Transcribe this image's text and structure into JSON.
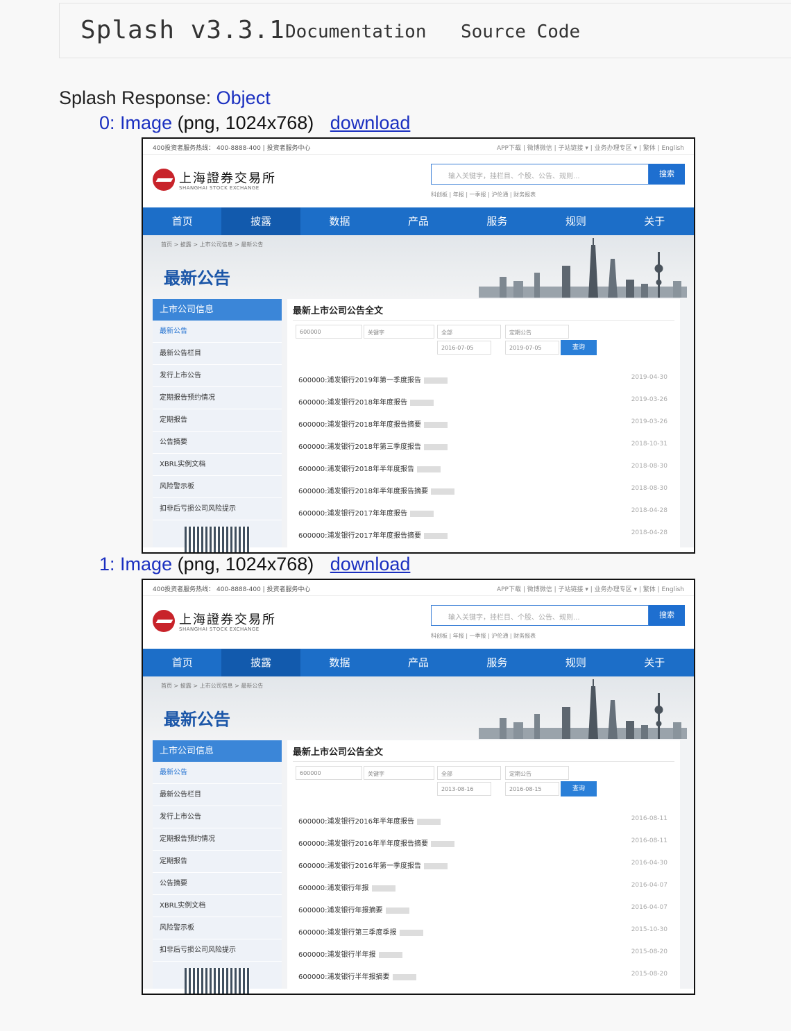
{
  "nav": {
    "brand": "Splash v3.3.1",
    "links": [
      "Documentation",
      "Source Code"
    ]
  },
  "response": {
    "label": "Splash Response:",
    "type": "Object"
  },
  "items": [
    {
      "index": "0:",
      "kind": "Image",
      "meta": "(png, 1024x768)",
      "link": "download",
      "shot": {
        "date_from": "2016-07-05",
        "date_to": "2019-07-05",
        "rows": [
          {
            "title": "600000:浦发银行2019年第一季度报告",
            "date": "2019-04-30"
          },
          {
            "title": "600000:浦发银行2018年年度报告",
            "date": "2019-03-26"
          },
          {
            "title": "600000:浦发银行2018年年度报告摘要",
            "date": "2019-03-26"
          },
          {
            "title": "600000:浦发银行2018年第三季度报告",
            "date": "2018-10-31"
          },
          {
            "title": "600000:浦发银行2018年半年度报告",
            "date": "2018-08-30"
          },
          {
            "title": "600000:浦发银行2018年半年度报告摘要",
            "date": "2018-08-30"
          },
          {
            "title": "600000:浦发银行2017年年度报告",
            "date": "2018-04-28"
          },
          {
            "title": "600000:浦发银行2017年年度报告摘要",
            "date": "2018-04-28"
          }
        ]
      }
    },
    {
      "index": "1:",
      "kind": "Image",
      "meta": "(png, 1024x768)",
      "link": "download",
      "shot": {
        "date_from": "2013-08-16",
        "date_to": "2016-08-15",
        "rows": [
          {
            "title": "600000:浦发银行2016年半年度报告",
            "date": "2016-08-11"
          },
          {
            "title": "600000:浦发银行2016年半年度报告摘要",
            "date": "2016-08-11"
          },
          {
            "title": "600000:浦发银行2016年第一季度报告",
            "date": "2016-04-30"
          },
          {
            "title": "600000:浦发银行年报",
            "date": "2016-04-07"
          },
          {
            "title": "600000:浦发银行年报摘要",
            "date": "2016-04-07"
          },
          {
            "title": "600000:浦发银行第三季度季报",
            "date": "2015-10-30"
          },
          {
            "title": "600000:浦发银行半年报",
            "date": "2015-08-20"
          },
          {
            "title": "600000:浦发银行半年报摘要",
            "date": "2015-08-20"
          }
        ]
      }
    }
  ],
  "sse": {
    "hotline": "400投资者服务热线： 400-8888-400 | 投资者服务中心",
    "toplinks": "APP下载 | 微博微信 | 子站链接 ▾ | 业务办理专区 ▾ | 繁体 | English",
    "logo_cn": "上海證券交易所",
    "logo_en": "SHANGHAI STOCK EXCHANGE",
    "search_placeholder": "输入关键字，挂栏目、个股、公告、规则...",
    "search_button": "搜索",
    "hotwords": "科创板 | 年报 | 一季报 | 沪伦通 | 财务报表",
    "menu": [
      "首页",
      "披露",
      "数据",
      "产品",
      "服务",
      "规则",
      "关于"
    ],
    "breadcrumb": "首页 > 披露 > 上市公司信息 > 最新公告",
    "banner_title": "最新公告",
    "side_head": "上市公司信息",
    "side_items": [
      "最新公告",
      "最新公告栏目",
      "发行上市公告",
      "定期报告预约情况",
      "定期报告",
      "公告摘要",
      "XBRL实例文档",
      "风险警示板",
      "扣非后亏损公司风险提示"
    ],
    "panel_title": "最新上市公司公告全文",
    "code": "600000",
    "keyword": "关键字",
    "type_all": "全部",
    "type_periodic": "定期公告",
    "query": "查询",
    "accent": "#1c6ec8"
  }
}
